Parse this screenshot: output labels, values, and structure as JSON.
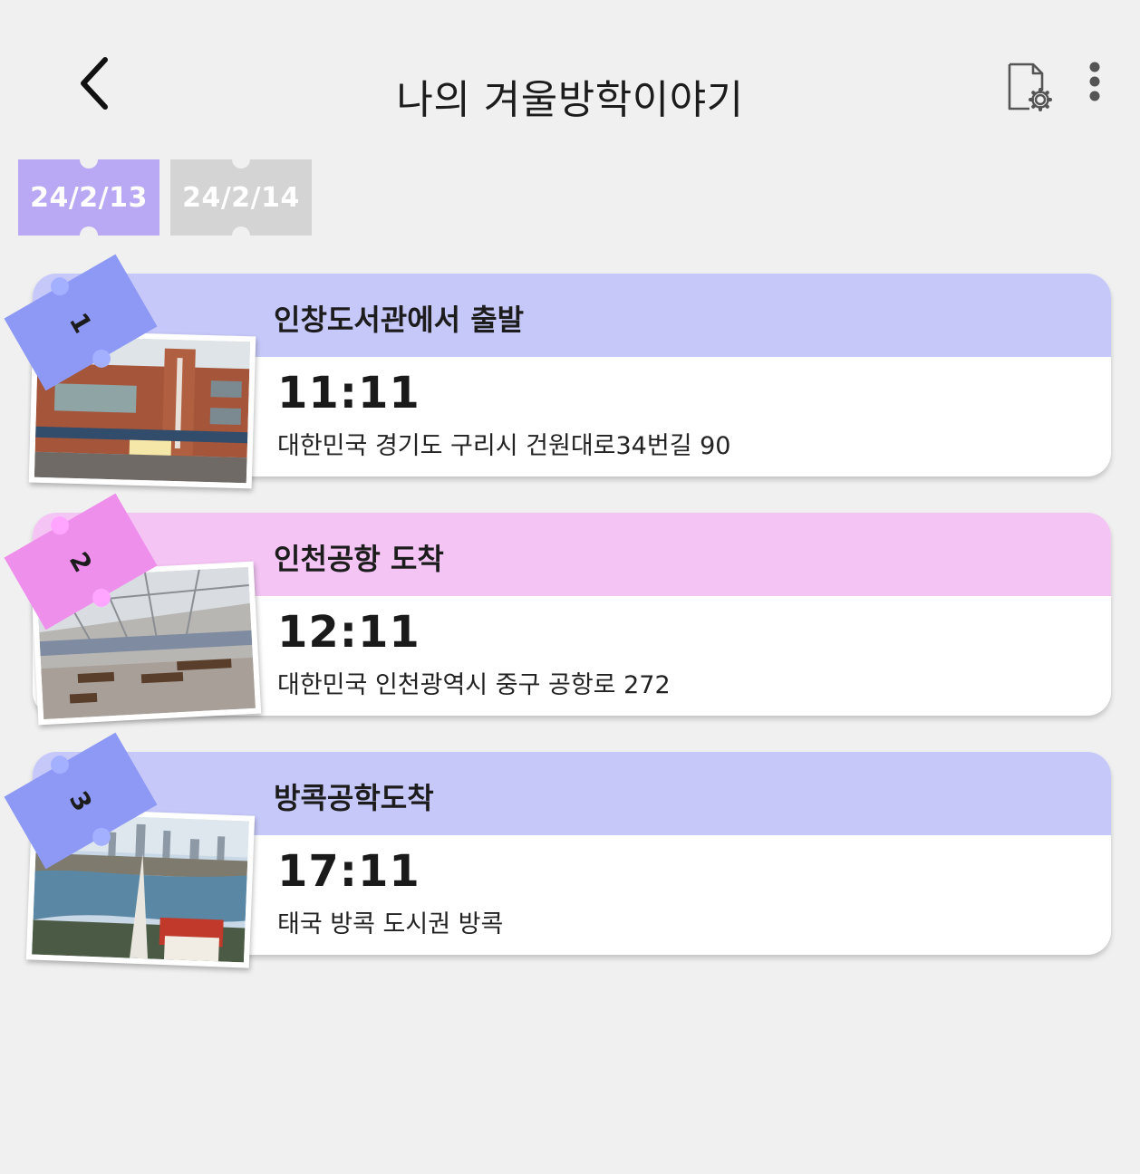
{
  "header": {
    "title": "나의 겨울방학이야기",
    "back_icon": "chevron-left-icon",
    "settings_icon": "document-settings-icon",
    "more_icon": "more-vertical-icon"
  },
  "date_tabs": [
    {
      "label": "24/2/13",
      "active": true
    },
    {
      "label": "24/2/14",
      "active": false
    }
  ],
  "colors": {
    "background": "#f0f0f0",
    "tab_active": "#b9a9f4",
    "tab_inactive": "#d4d4d4",
    "card_head_blue": "#c6c8f9",
    "card_head_pink": "#f4c4f4",
    "ticket_blue": "#8e99f5",
    "ticket_pink": "#ef8fec"
  },
  "schedule": [
    {
      "number": "1",
      "title": "인창도서관에서 출발",
      "time": "11:11",
      "address": "대한민국 경기도 구리시 건원대로34번길 90",
      "photo": "library-building-photo",
      "theme": "blue"
    },
    {
      "number": "2",
      "title": "인천공항 도착",
      "time": "12:11",
      "address": "대한민국 인천광역시 중구 공항로 272",
      "photo": "airport-terminal-photo",
      "theme": "pink"
    },
    {
      "number": "3",
      "title": "방콕공학도착",
      "time": "17:11",
      "address": "태국 방콕 도시권 방콕",
      "photo": "bangkok-city-photo",
      "theme": "blue"
    }
  ]
}
